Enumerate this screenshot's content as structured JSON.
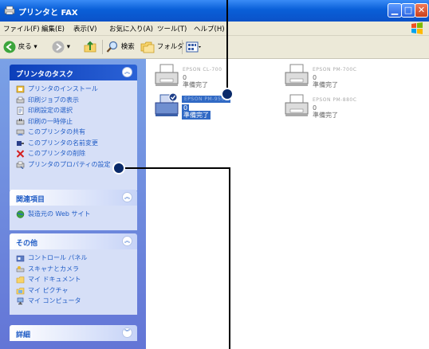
{
  "window": {
    "title": "プリンタと FAX"
  },
  "menu": [
    "ファイル(F)",
    "編集(E)",
    "表示(V)",
    "お気に入り(A)",
    "ツール(T)",
    "ヘルプ(H)"
  ],
  "toolbar": {
    "back": "戻る",
    "search": "検索",
    "folders": "フォルダ"
  },
  "sidebar": {
    "tasks": {
      "title": "プリンタのタスク",
      "items": [
        {
          "label": "プリンタのインストール",
          "icon": "printer-add-icon"
        },
        {
          "label": "印刷ジョブの表示",
          "icon": "print-jobs-icon"
        },
        {
          "label": "印刷設定の選択",
          "icon": "print-settings-icon"
        },
        {
          "label": "印刷の一時停止",
          "icon": "pause-printing-icon"
        },
        {
          "label": "このプリンタの共有",
          "icon": "share-printer-icon"
        },
        {
          "label": "このプリンタの名前変更",
          "icon": "rename-printer-icon"
        },
        {
          "label": "このプリンタの削除",
          "icon": "delete-icon"
        },
        {
          "label": "プリンタのプロパティの設定",
          "icon": "printer-properties-icon"
        }
      ]
    },
    "related": {
      "title": "関連項目",
      "items": [
        {
          "label": "製造元の Web サイト",
          "icon": "web-site-icon"
        }
      ]
    },
    "other": {
      "title": "その他",
      "items": [
        {
          "label": "コントロール パネル",
          "icon": "control-panel-icon"
        },
        {
          "label": "スキャナとカメラ",
          "icon": "scanner-camera-icon"
        },
        {
          "label": "マイ ドキュメント",
          "icon": "my-documents-icon"
        },
        {
          "label": "マイ ピクチャ",
          "icon": "my-pictures-icon"
        },
        {
          "label": "マイ コンピュータ",
          "icon": "my-computer-icon"
        }
      ]
    },
    "details": {
      "title": "詳細"
    }
  },
  "printers": [
    {
      "name": "EPSON CL-700",
      "count": "0",
      "status": "準備完了",
      "selected": false
    },
    {
      "name": "EPSON PM-700C",
      "count": "0",
      "status": "準備完了",
      "selected": false
    },
    {
      "name": "EPSON PM-950C",
      "count": "0",
      "status": "準備完了",
      "selected": true
    },
    {
      "name": "EPSON PM-880C",
      "count": "0",
      "status": "準備完了",
      "selected": false
    }
  ],
  "colors": {
    "title_bar": "#0b52c8",
    "sidebar": "#6e8ddd",
    "panel_text": "#215dc6",
    "selection": "#316ac5",
    "callout": "#0a2a6a"
  }
}
